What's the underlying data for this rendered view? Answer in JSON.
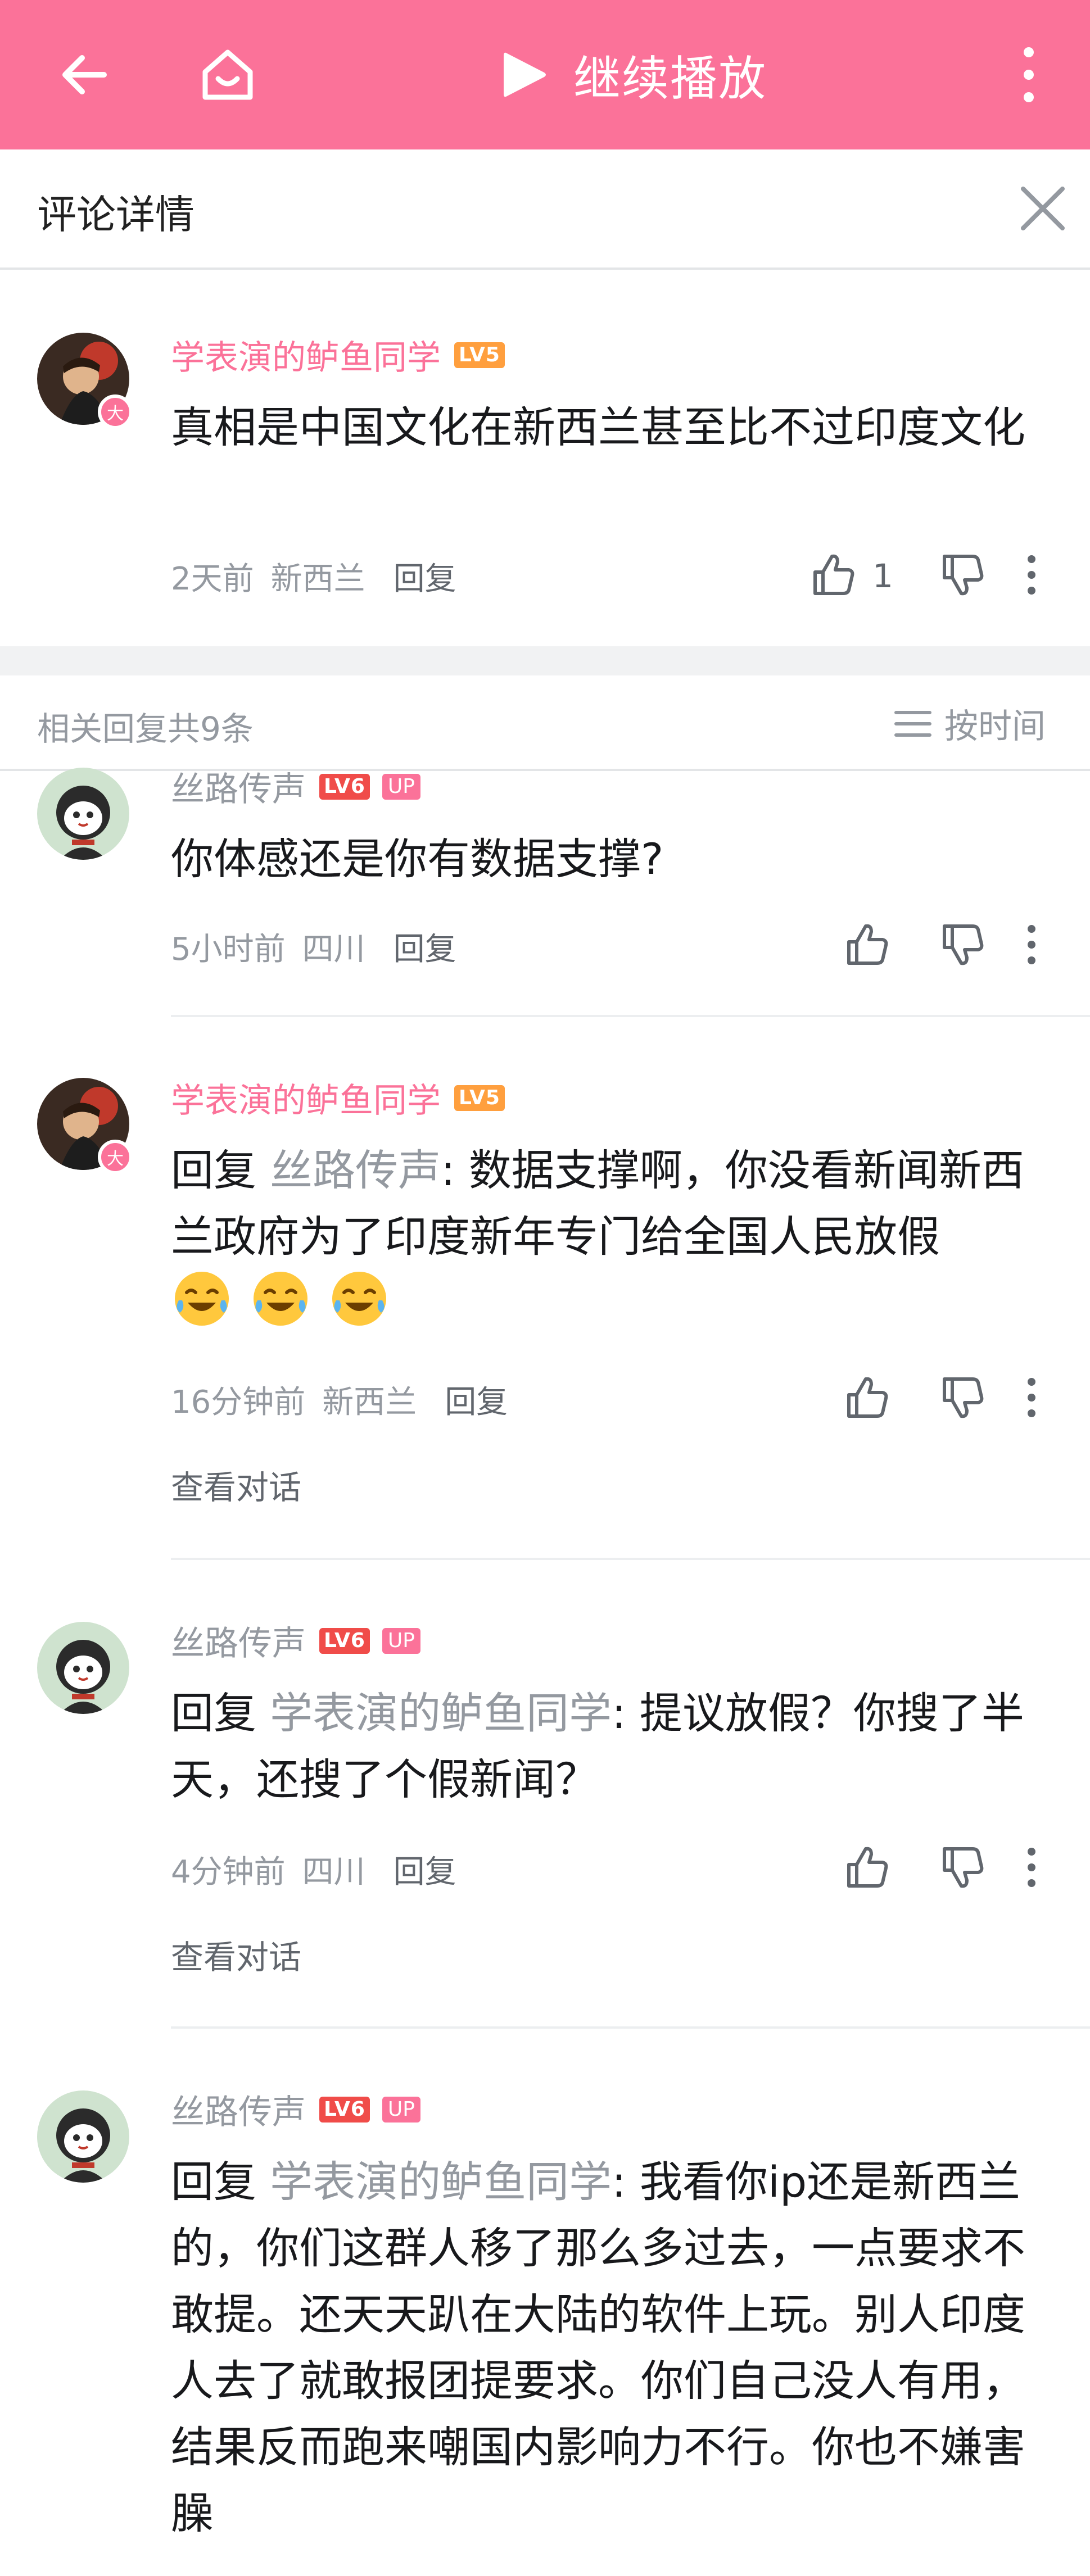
{
  "topbar": {
    "play_label": "继续播放",
    "icons": {
      "back": "back-arrow-icon",
      "home": "home-icon",
      "play": "play-icon",
      "more": "more-vertical-icon"
    }
  },
  "header": {
    "title": "评论详情",
    "close_icon": "close-icon"
  },
  "root_comment": {
    "username": "学表演的鲈鱼同学",
    "level": "LV5",
    "avatar_badge": "大",
    "text": "真相是中国文化在新西兰甚至比不过印度文化",
    "time": "2天前",
    "location": "新西兰",
    "reply_label": "回复",
    "like_count": "1"
  },
  "related": {
    "count_label": "相关回复共9条",
    "sort_label": "按时间"
  },
  "replies": [
    {
      "username": "丝路传声",
      "level": "LV6",
      "up_badge": "UP",
      "reply_prefix": "",
      "reply_target": "",
      "text": "你体感还是你有数据支撑?",
      "time": "5小时前",
      "location": "四川",
      "reply_label": "回复"
    },
    {
      "username": "学表演的鲈鱼同学",
      "level": "LV5",
      "avatar_badge": "大",
      "reply_prefix": "回复 ",
      "reply_target": "丝路传声",
      "text": ": 数据支撑啊，你没看新闻新西兰政府为了印度新年专门给全国人民放假",
      "emoji_count": 3,
      "time": "16分钟前",
      "location": "新西兰",
      "reply_label": "回复",
      "view_conversation": "查看对话"
    },
    {
      "username": "丝路传声",
      "level": "LV6",
      "up_badge": "UP",
      "reply_prefix": "回复 ",
      "reply_target": "学表演的鲈鱼同学",
      "text": ": 提议放假？你搜了半天，还搜了个假新闻？",
      "time": "4分钟前",
      "location": "四川",
      "reply_label": "回复",
      "view_conversation": "查看对话"
    },
    {
      "username": "丝路传声",
      "level": "LV6",
      "up_badge": "UP",
      "reply_prefix": "回复 ",
      "reply_target": "学表演的鲈鱼同学",
      "text": ": 我看你ip还是新西兰的，你们这群人移了那么多过去，一点要求不敢提。还天天趴在大陆的软件上玩。别人印度人去了就敢报团提要求。你们自己没人有用，结果反而跑来嘲国内影响力不行。你也不嫌害臊"
    }
  ],
  "colors": {
    "brand_pink": "#fb7299",
    "lv5": "#ff9f3e",
    "lv6": "#f04c49",
    "meta_gray": "#9499a0"
  }
}
